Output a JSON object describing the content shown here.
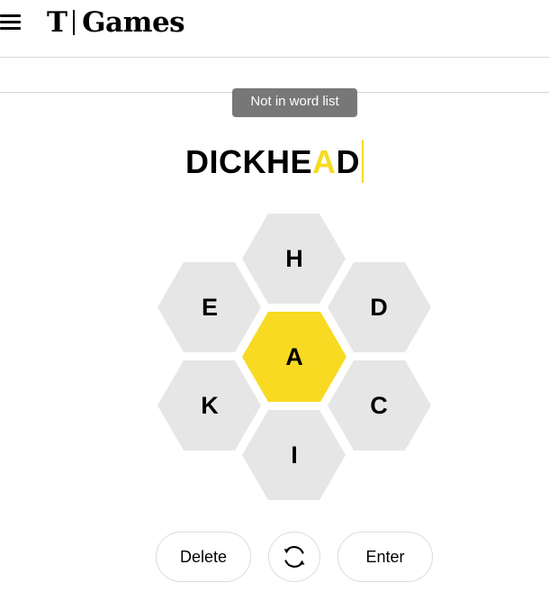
{
  "header": {
    "logo_mark": "T",
    "logo_text": "Games"
  },
  "toast": {
    "message": "Not in word list"
  },
  "current_word": {
    "before_highlight": "DICKHE",
    "highlight": "A",
    "after_highlight": "D",
    "highlight_color": "#f7da21"
  },
  "hive": {
    "center_letter": "A",
    "outer_letters": [
      "H",
      "D",
      "C",
      "I",
      "K",
      "E"
    ],
    "center_color": "#f7da21",
    "outer_color": "#e6e6e6"
  },
  "buttons": {
    "delete_label": "Delete",
    "shuffle_icon": "shuffle-icon",
    "enter_label": "Enter"
  }
}
